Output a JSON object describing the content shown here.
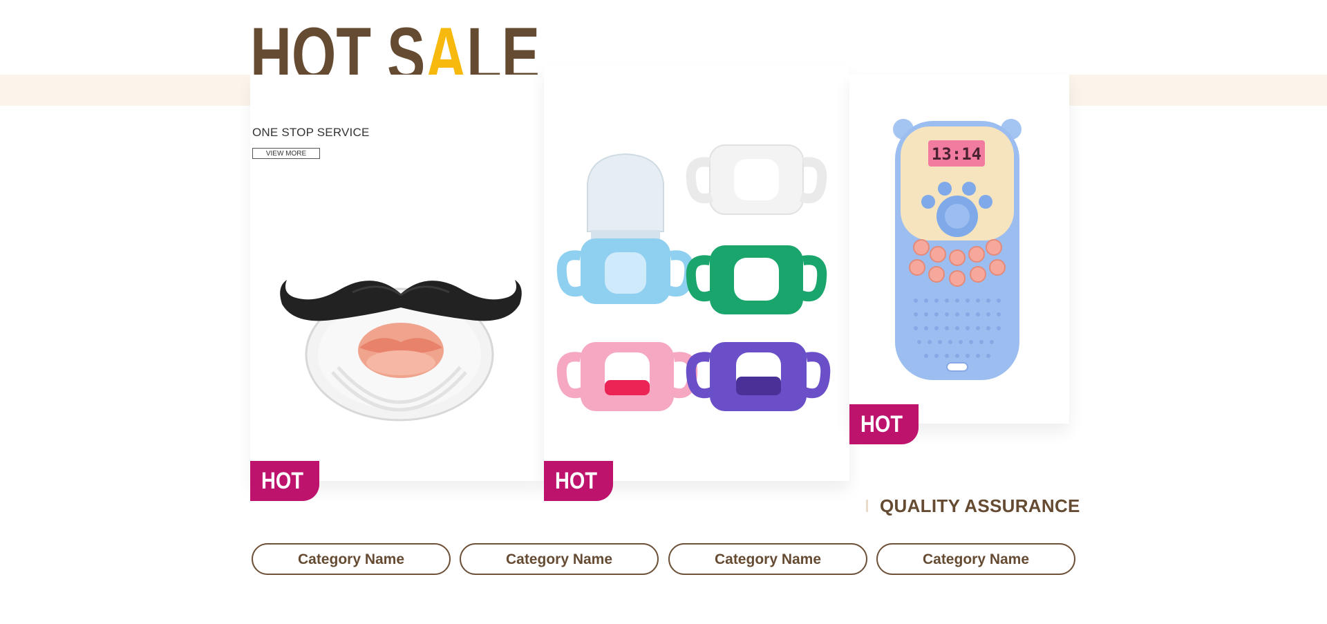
{
  "header": {
    "title_prefix": "HOT S",
    "title_accent": "A",
    "title_suffix": "LE",
    "subtitle": "ONE STOP SERVICE",
    "view_more": "VIEW MORE"
  },
  "products": [
    {
      "badge": "HOT",
      "image": "mustache-pacifier"
    },
    {
      "badge": "HOT",
      "image": "silicone-bottle-sleeves"
    },
    {
      "badge": "HOT",
      "image": "baby-phone-teether-toy"
    }
  ],
  "quality": {
    "label": "QUALITY ASSURANCE"
  },
  "categories": [
    {
      "label": "Category Name"
    },
    {
      "label": "Category Name"
    },
    {
      "label": "Category Name"
    },
    {
      "label": "Category Name"
    }
  ],
  "colors": {
    "brown": "#664b33",
    "accent_yellow": "#f7b90d",
    "hot_badge": "#bd136d",
    "band": "#fbf4ea"
  }
}
